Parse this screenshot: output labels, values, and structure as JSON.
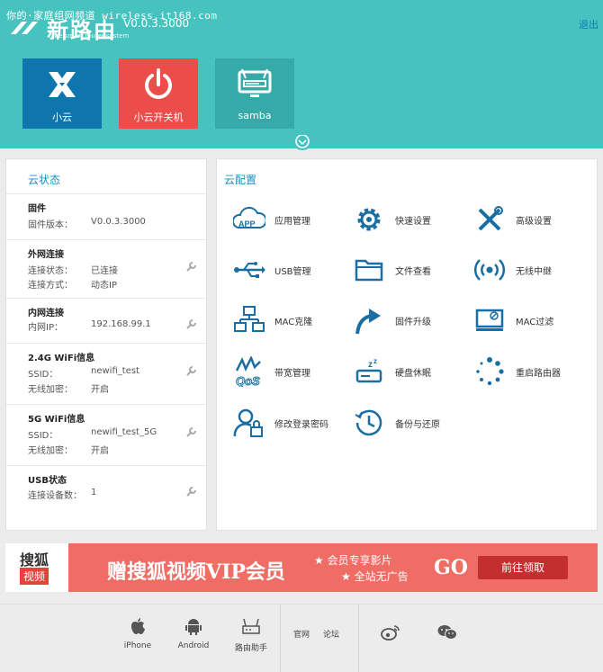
{
  "watermark": "你的·家庭组网频道 wireless.it168.com",
  "header": {
    "logo_text": "新路由",
    "version": "V0.0.3.3000",
    "tagline": "the smart router system",
    "logout": "退出"
  },
  "tiles": [
    {
      "label": "小云",
      "icon": "x-logo-icon"
    },
    {
      "label": "小云开关机",
      "icon": "power-icon"
    },
    {
      "label": "samba",
      "icon": "monitor-icon"
    }
  ],
  "status_panel": {
    "title": "云状态",
    "sections": [
      {
        "heading": "固件",
        "rows": [
          {
            "label": "固件版本：",
            "value": "V0.0.3.3000"
          }
        ]
      },
      {
        "heading": "外网连接",
        "rows": [
          {
            "label": "连接状态：",
            "value": "已连接"
          },
          {
            "label": "连接方式：",
            "value": "动态IP"
          }
        ]
      },
      {
        "heading": "内网连接",
        "rows": [
          {
            "label": "内网IP：",
            "value": "192.168.99.1"
          }
        ]
      },
      {
        "heading": "2.4G WiFi信息",
        "rows": [
          {
            "label": "SSID：",
            "value": "newifi_test"
          },
          {
            "label": "无线加密：",
            "value": "开启"
          }
        ]
      },
      {
        "heading": "5G WiFi信息",
        "rows": [
          {
            "label": "SSID：",
            "value": "newifi_test_5G"
          },
          {
            "label": "无线加密：",
            "value": "开启"
          }
        ]
      },
      {
        "heading": "USB状态",
        "rows": [
          {
            "label": "连接设备数：",
            "value": "1"
          }
        ]
      }
    ]
  },
  "config_panel": {
    "title": "云配置",
    "items": [
      {
        "label": "应用管理",
        "icon": "app-cloud-icon"
      },
      {
        "label": "快速设置",
        "icon": "gear-icon"
      },
      {
        "label": "高级设置",
        "icon": "tools-icon"
      },
      {
        "label": "USB管理",
        "icon": "usb-icon"
      },
      {
        "label": "文件查看",
        "icon": "folder-icon"
      },
      {
        "label": "无线中继",
        "icon": "wireless-icon"
      },
      {
        "label": "MAC克隆",
        "icon": "network-icon"
      },
      {
        "label": "固件升级",
        "icon": "upgrade-arrow-icon"
      },
      {
        "label": "MAC过滤",
        "icon": "monitor-block-icon"
      },
      {
        "label": "带宽管理",
        "icon": "qos-icon"
      },
      {
        "label": "硬盘休眠",
        "icon": "disk-sleep-icon"
      },
      {
        "label": "重启路由器",
        "icon": "spinner-icon"
      },
      {
        "label": "修改登录密码",
        "icon": "user-lock-icon"
      },
      {
        "label": "备份与还原",
        "icon": "history-icon"
      }
    ]
  },
  "banner": {
    "brand_top": "搜狐",
    "brand_bottom": "视频",
    "headline": "赠搜狐视频VIP会员",
    "perk1": "★ 会员专享影片",
    "perk2": "★ 全站无广告",
    "go": "GO",
    "cta": "前往领取"
  },
  "footer": {
    "apps": [
      {
        "label": "iPhone",
        "icon": "apple-icon"
      },
      {
        "label": "Android",
        "icon": "android-icon"
      },
      {
        "label": "路由助手",
        "icon": "router-icon"
      }
    ],
    "links": [
      "官网",
      "论坛"
    ],
    "social": [
      {
        "icon": "weibo-icon"
      },
      {
        "icon": "wechat-icon"
      }
    ]
  }
}
